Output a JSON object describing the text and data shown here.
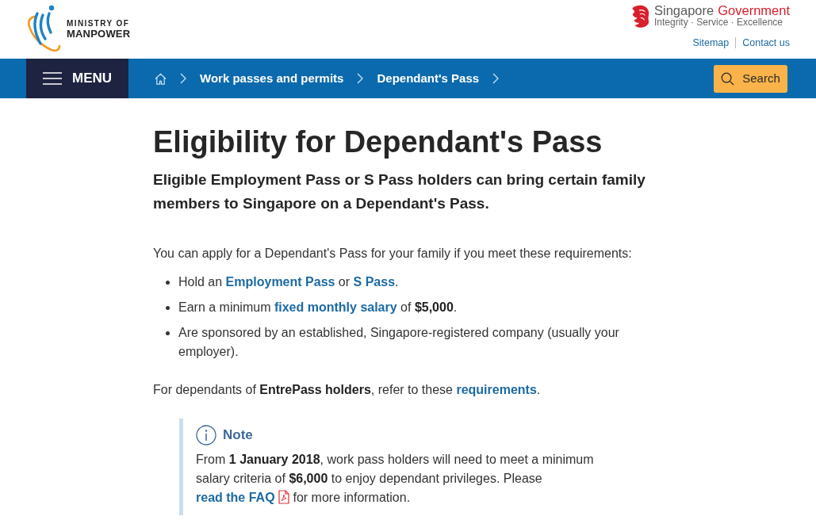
{
  "header": {
    "logo_text": [
      "MINISTRY OF",
      "MANPOWER"
    ],
    "gov": {
      "name_first": "Singapore",
      "name_second": "Government",
      "tagline": "Integrity · Service · Excellence"
    },
    "links": [
      {
        "label": "Sitemap"
      },
      {
        "label": "Contact us"
      }
    ]
  },
  "nav": {
    "menu_label": "MENU",
    "breadcrumbs": [
      {
        "label": "Work passes and permits"
      },
      {
        "label": "Dependant's Pass"
      }
    ],
    "search_label": "Search"
  },
  "page": {
    "title": "Eligibility for Dependant's Pass",
    "lead": "Eligible Employment Pass or S Pass holders can bring certain family members to Singapore on a Dependant's Pass.",
    "intro": "You can apply for a Dependant's Pass for your family if you meet these requirements:",
    "requirements": [
      [
        {
          "kind": "text",
          "text": "Hold an "
        },
        {
          "kind": "link",
          "text": "Employment Pass"
        },
        {
          "kind": "text",
          "text": " or "
        },
        {
          "kind": "link",
          "text": "S Pass"
        },
        {
          "kind": "text",
          "text": "."
        }
      ],
      [
        {
          "kind": "text",
          "text": "Earn a minimum "
        },
        {
          "kind": "link",
          "text": "fixed monthly salary"
        },
        {
          "kind": "text",
          "text": " of "
        },
        {
          "kind": "bold",
          "text": "$5,000"
        },
        {
          "kind": "text",
          "text": "."
        }
      ],
      [
        {
          "kind": "text",
          "text": "Are sponsored by an established, Singapore-registered company (usually your employer)."
        }
      ]
    ],
    "entrepass": [
      {
        "kind": "text",
        "text": "For dependants of "
      },
      {
        "kind": "bold",
        "text": "EntrePass holders"
      },
      {
        "kind": "text",
        "text": ", refer to these "
      },
      {
        "kind": "link",
        "text": "requirements"
      },
      {
        "kind": "text",
        "text": "."
      }
    ],
    "note": {
      "title": "Note",
      "body": [
        {
          "kind": "text",
          "text": "From "
        },
        {
          "kind": "bold",
          "text": "1 January 2018"
        },
        {
          "kind": "text",
          "text": ", work pass holders will need to meet a minimum salary criteria of "
        },
        {
          "kind": "bold",
          "text": "$6,000"
        },
        {
          "kind": "text",
          "text": " to enjoy dependant privileges. Please "
        },
        {
          "kind": "link",
          "text": "read the FAQ",
          "file": true
        },
        {
          "kind": "text",
          "text": " for more information."
        }
      ]
    }
  }
}
